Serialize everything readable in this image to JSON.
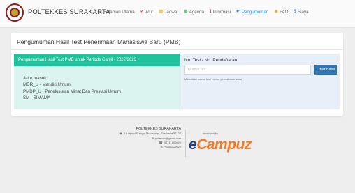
{
  "header": {
    "brand": "POLTEKKES SURAKARTA",
    "nav": [
      {
        "label": "Halaman Utama",
        "icon": "home-icon",
        "color": "#2fa84f"
      },
      {
        "label": "Alur",
        "icon": "check-icon",
        "color": "#e23b3b"
      },
      {
        "label": "Jadwal",
        "icon": "calendar-icon",
        "color": "#e0b030"
      },
      {
        "label": "Agenda",
        "icon": "agenda-icon",
        "color": "#2fa84f"
      },
      {
        "label": "Informasi",
        "icon": "info-icon",
        "color": "#e23b3b"
      },
      {
        "label": "Pengumuman",
        "icon": "megaphone-icon",
        "color": "#1e8fd6",
        "active": true
      },
      {
        "label": "FAQ",
        "icon": "question-icon",
        "color": "#e0b030"
      },
      {
        "label": "Biaya",
        "icon": "dollar-icon",
        "color": "#2e75b6"
      }
    ]
  },
  "card": {
    "title": "Pengumuman Hasil Test Penerimaan Mahasiswa Baru (PMB)",
    "left": {
      "header": "Pengumuman Hasil Test PMB untuk Periode Ganjil - 2022/2023",
      "jalur_label": "Jalur masuk:",
      "jalur": [
        "MDR_U - Mandiri Umum",
        "PMDP_U - Penelusuran Minat Dan Prestasi Umum",
        "SM - SIMAMA"
      ]
    },
    "right": {
      "title": "No. Test / No. Pendaftaran",
      "input_placeholder": "Nomor tes",
      "button": "Lihat hasil",
      "help": "Masukkan nomor tes / nomor pendaftaran anda"
    }
  },
  "footer": {
    "name": "POLTEKKES SURAKARTA",
    "address": "Jl. Letjend Sutoyo, Mojosongo, Surakarta 57127",
    "email": "poltesolo@gmail.com",
    "phone": "(0271) 856929",
    "whatsapp": "+6281226929",
    "developed_by": "developed by",
    "dev_brand_e": "e",
    "dev_brand_rest": "Campuz"
  },
  "colors": {
    "accent_green": "#20c29d",
    "button_blue": "#2e75b6",
    "brand_orange": "#f47920"
  }
}
